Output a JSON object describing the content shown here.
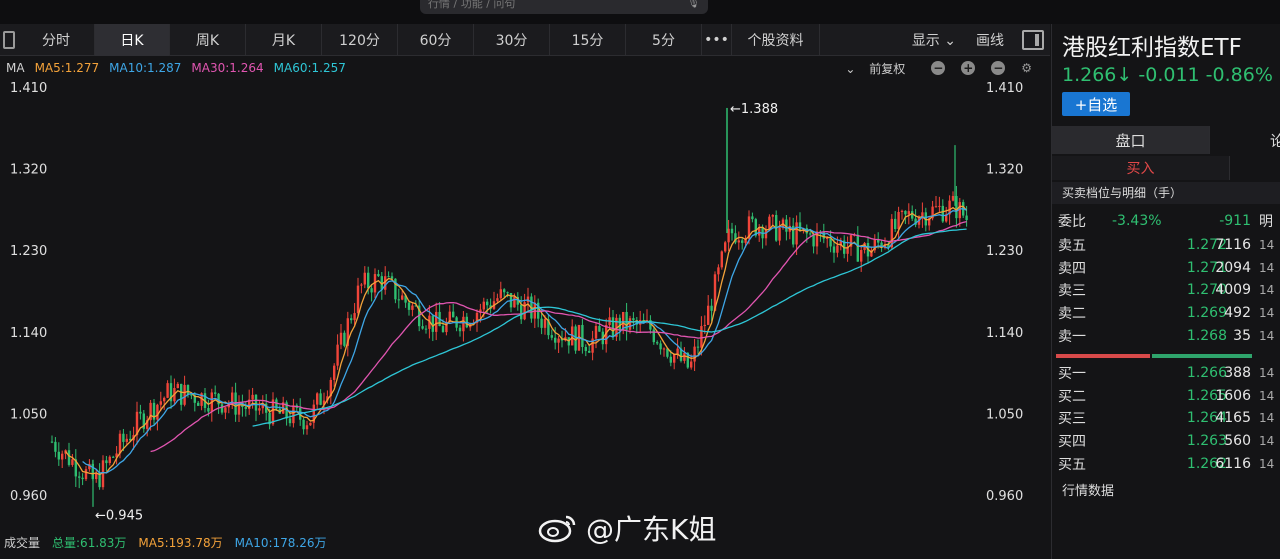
{
  "search": {
    "placeholder": "行情 / 功能 / 问句"
  },
  "toolbar": {
    "tabs": [
      "分时",
      "日K",
      "周K",
      "月K",
      "120分",
      "60分",
      "30分",
      "15分",
      "5分",
      "•••",
      "个股资料"
    ],
    "active_tab": "日K",
    "display_label": "显示",
    "draw_label": "画线"
  },
  "ma_legend": {
    "label": "MA",
    "ma5": "MA5:1.277",
    "ma10": "MA10:1.287",
    "ma30": "MA30:1.264",
    "ma60": "MA60:1.257",
    "adjust": "前复权"
  },
  "volume": {
    "label": "成交量",
    "total": "总量:61.83万",
    "ma5": "MA5:193.78万",
    "ma10": "MA10:178.26万"
  },
  "watermark": "@广东K姐",
  "stock": {
    "name": "港股红利指数ETF",
    "price": "1.266↓",
    "change": "-0.011",
    "change_pct": "-0.86%",
    "add_watchlist": "+自选"
  },
  "panel": {
    "tab_active": "盘口",
    "tab_other": "论",
    "buy_label": "买入",
    "section_title": "买卖档位与明细（手）",
    "ratio_label": "委比",
    "ratio_pct": "-3.43%",
    "ratio_diff": "-911",
    "detail_label": "明",
    "asks": [
      {
        "label": "卖五",
        "price": "1.272",
        "volume": "7116"
      },
      {
        "label": "卖四",
        "price": "1.271",
        "volume": "2094"
      },
      {
        "label": "卖三",
        "price": "1.270",
        "volume": "4009"
      },
      {
        "label": "卖二",
        "price": "1.269",
        "volume": "492"
      },
      {
        "label": "卖一",
        "price": "1.268",
        "volume": "35"
      }
    ],
    "bids": [
      {
        "label": "买一",
        "price": "1.266",
        "volume": "388"
      },
      {
        "label": "买二",
        "price": "1.265",
        "volume": "1606"
      },
      {
        "label": "买三",
        "price": "1.264",
        "volume": "4165"
      },
      {
        "label": "买四",
        "price": "1.263",
        "volume": "560"
      },
      {
        "label": "买五",
        "price": "1.262",
        "volume": "6116"
      }
    ],
    "side_times": [
      "14",
      "14",
      "14",
      "14",
      "14",
      "14",
      "14",
      "14",
      "14",
      "14",
      "14",
      "15"
    ],
    "market_data": "行情数据"
  },
  "chart_data": {
    "type": "candlestick",
    "y_ticks": [
      "1.410",
      "1.320",
      "1.230",
      "1.140",
      "1.050",
      "0.960"
    ],
    "ylim": [
      0.945,
      1.41
    ],
    "annotations": {
      "high": "←1.388",
      "low": "←0.945"
    },
    "series_colors": {
      "up": "#f0453a",
      "down": "#2fbf71",
      "ma5": "#f3a23a",
      "ma10": "#3ea6e6",
      "ma30": "#e055b0",
      "ma60": "#2ec6d6"
    }
  }
}
